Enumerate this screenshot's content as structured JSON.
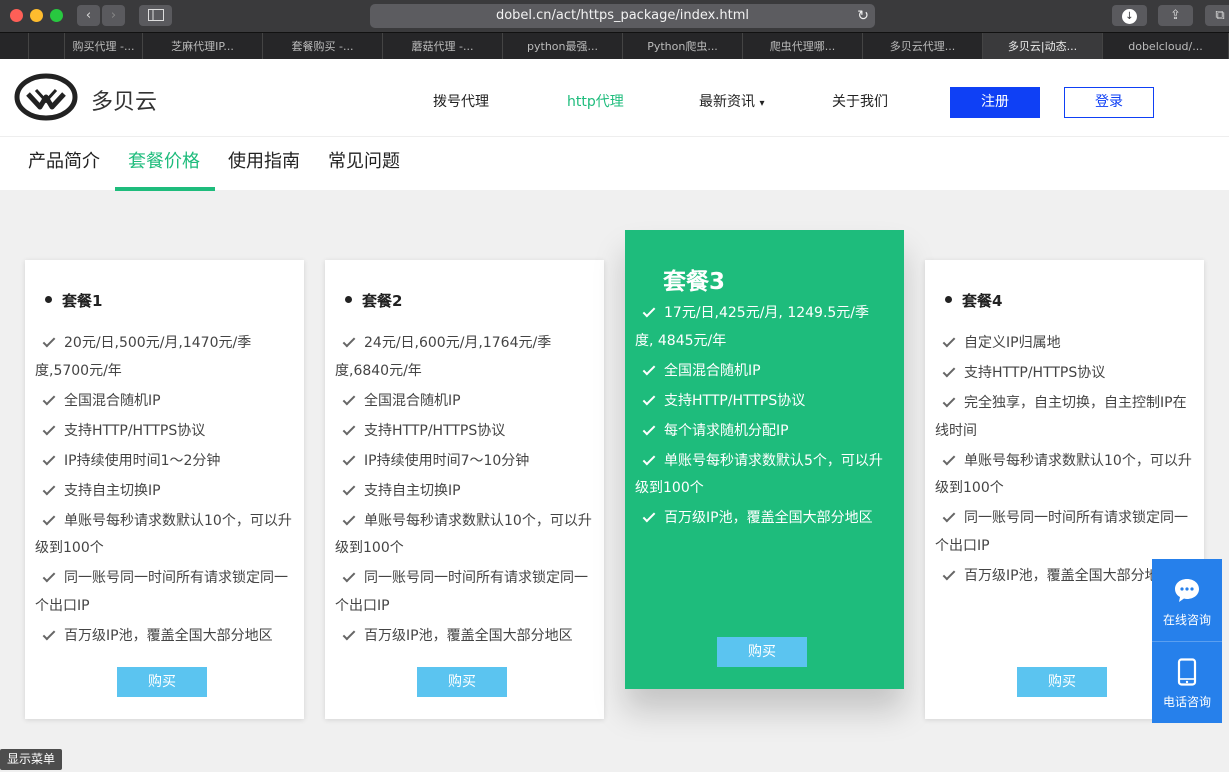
{
  "browser": {
    "url": "dobel.cn/act/https_package/index.html",
    "tabs": [
      "购买代理 -...",
      "芝麻代理IP...",
      "套餐购买 -...",
      "蘑菇代理 -...",
      "python最强...",
      "Python爬虫...",
      "爬虫代理哪...",
      "多贝云代理...",
      "多贝云|动态...",
      "dobelcloud/..."
    ]
  },
  "site": {
    "logo_text": "多贝云",
    "nav": [
      "拨号代理",
      "http代理",
      "最新资讯",
      "关于我们"
    ],
    "register": "注册",
    "login": "登录"
  },
  "subnav": [
    "产品简介",
    "套餐价格",
    "使用指南",
    "常见问题"
  ],
  "cards": [
    {
      "title": "套餐1",
      "features": [
        "20元/日,500元/月,1470元/季度,5700元/年",
        "全国混合随机IP",
        "支持HTTP/HTTPS协议",
        "IP持续使用时间1～2分钟",
        "支持自主切换IP",
        "单账号每秒请求数默认10个，可以升级到100个",
        "同一账号同一时间所有请求锁定同一个出口IP",
        "百万级IP池，覆盖全国大部分地区"
      ],
      "buy": "购买"
    },
    {
      "title": "套餐2",
      "features": [
        "24元/日,600元/月,1764元/季度,6840元/年",
        "全国混合随机IP",
        "支持HTTP/HTTPS协议",
        "IP持续使用时间7～10分钟",
        "支持自主切换IP",
        "单账号每秒请求数默认10个，可以升级到100个",
        "同一账号同一时间所有请求锁定同一个出口IP",
        "百万级IP池，覆盖全国大部分地区"
      ],
      "buy": "购买"
    },
    {
      "title": "套餐3",
      "features": [
        "17元/日,425元/月, 1249.5元/季度, 4845元/年",
        "全国混合随机IP",
        "支持HTTP/HTTPS协议",
        "每个请求随机分配IP",
        "单账号每秒请求数默认5个，可以升级到100个",
        "百万级IP池，覆盖全国大部分地区"
      ],
      "buy": "购买"
    },
    {
      "title": "套餐4",
      "features": [
        "自定义IP归属地",
        "支持HTTP/HTTPS协议",
        "完全独享，自主切换，自主控制IP在线时间",
        "单账号每秒请求数默认10个，可以升级到100个",
        "同一账号同一时间所有请求锁定同一个出口IP",
        "百万级IP池，覆盖全国大部分地区"
      ],
      "buy": "购买"
    }
  ],
  "side": {
    "online": "在线咨询",
    "phone": "电话咨询"
  },
  "menu_button": "显示菜单"
}
